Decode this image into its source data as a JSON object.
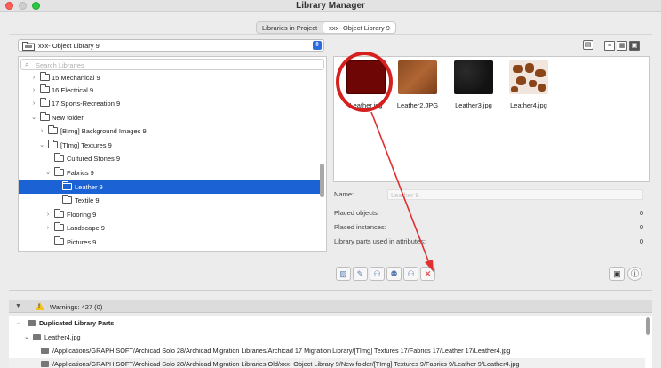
{
  "window": {
    "title": "Library Manager"
  },
  "tabs": [
    {
      "label": "Libraries in Project",
      "active": false
    },
    {
      "label": "xxx- Object Library 9",
      "active": true
    }
  ],
  "library_selector": {
    "value": "xxx- Object Library 9"
  },
  "search": {
    "placeholder": "Search Libraries"
  },
  "tree": [
    {
      "label": "15 Mechanical 9",
      "chevron": "›"
    },
    {
      "label": "16 Electrical 9",
      "chevron": "›"
    },
    {
      "label": "17 Sports-Recreation 9",
      "chevron": "›"
    },
    {
      "label": "New folder",
      "chevron": "⌄"
    },
    {
      "label": "[BImg] Background Images 9",
      "chevron": "›"
    },
    {
      "label": "[TImg] Textures 9",
      "chevron": "⌄"
    },
    {
      "label": "Cultured Stones 9",
      "chevron": ""
    },
    {
      "label": "Fabrics 9",
      "chevron": "⌄"
    },
    {
      "label": "Leather 9",
      "chevron": "",
      "selected": true
    },
    {
      "label": "Textile 9",
      "chevron": ""
    },
    {
      "label": "Flooring 9",
      "chevron": "›"
    },
    {
      "label": "Landscape 9",
      "chevron": "›"
    },
    {
      "label": "Pictures 9",
      "chevron": ""
    }
  ],
  "thumbnails": [
    {
      "name": "Leather.jpg",
      "color": "#6f0606"
    },
    {
      "name": "Leather2.JPG",
      "color": "#a0582c"
    },
    {
      "name": "Leather3.jpg",
      "color": "#1b1b1b"
    },
    {
      "name": "Leather4.jpg",
      "color": "#8a4619"
    }
  ],
  "details": {
    "name_label": "Name:",
    "name_value": "Leather 9",
    "placed_objects_label": "Placed objects:",
    "placed_objects_value": "0",
    "placed_instances_label": "Placed instances:",
    "placed_instances_value": "0",
    "attributes_label": "Library parts used in attributes:",
    "attributes_value": "0"
  },
  "warnings": {
    "header": "Warnings: 427 (0)",
    "section": "Duplicated Library Parts",
    "item": "Leather4.jpg",
    "paths": [
      "/Applications/GRAPHISOFT/Archicad Solo 28/Archicad Migration Libraries/Archicad 17 Migration Library/[TImg] Textures 17/Fabrics 17/Leather 17/Leather4.jpg",
      "/Applications/GRAPHISOFT/Archicad Solo 28/Archicad Migration Libraries Old/xxx- Object Library 9/New folder/[TImg] Textures 9/Fabrics 9/Leather 9/Leather4.jpg"
    ]
  },
  "colors": {
    "selection": "#1b62d4",
    "annotation": "#d62020",
    "warning": "#f3c319"
  }
}
